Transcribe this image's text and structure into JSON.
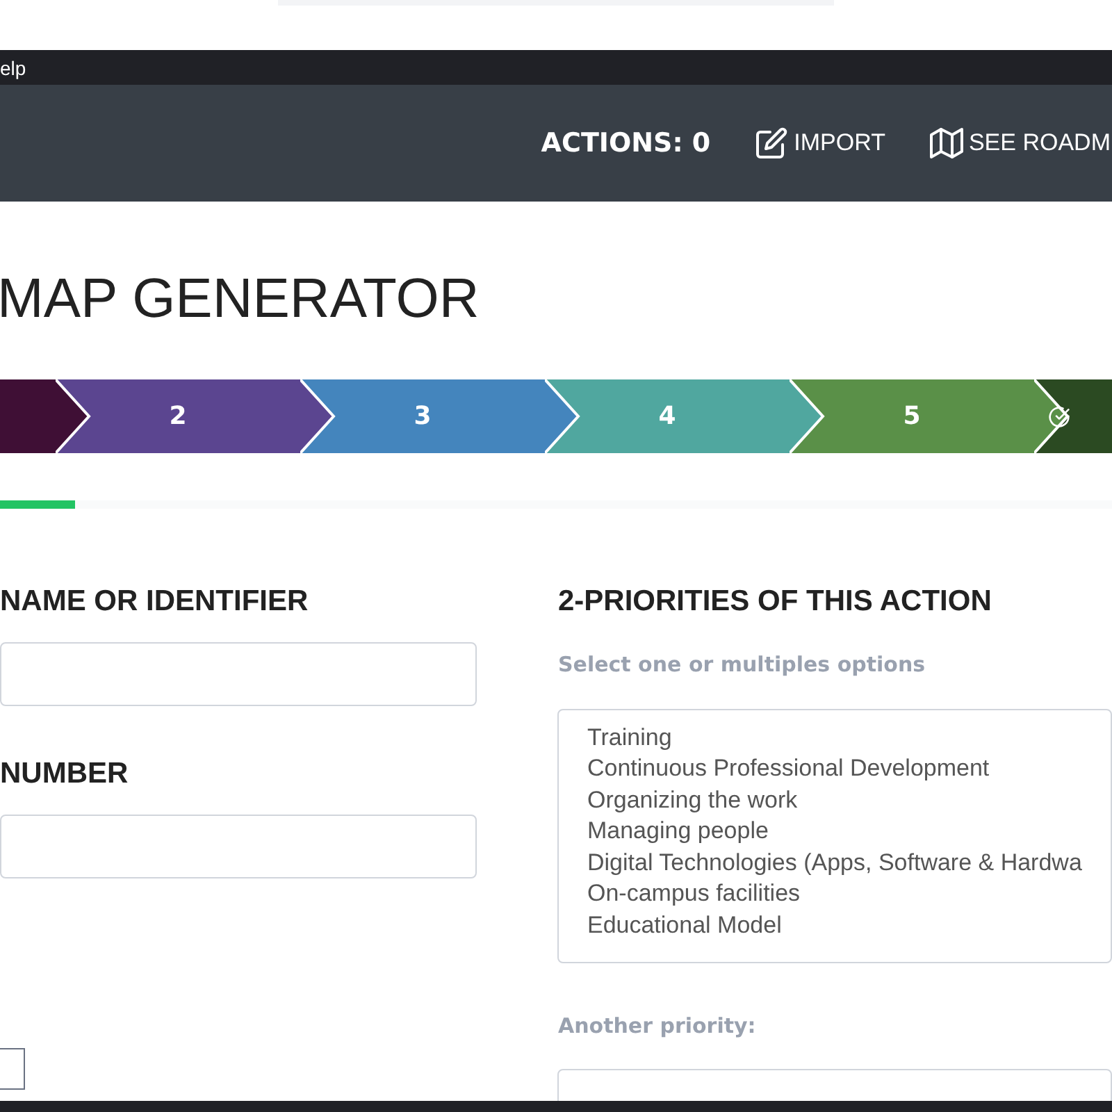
{
  "menu_bar": {
    "item": "elp"
  },
  "header": {
    "actions_count": "ACTIONS: 0",
    "links": [
      {
        "label": "IMPORT",
        "kind": "edit"
      },
      {
        "label": "SEE ROADM",
        "kind": "map"
      }
    ]
  },
  "page_title": "MAP GENERATOR",
  "steps": [
    {
      "kind": "blank",
      "color": "#3f0f35"
    },
    {
      "kind": "number",
      "label": "2",
      "color": "#5b4590"
    },
    {
      "kind": "number",
      "label": "3",
      "color": "#4485bd"
    },
    {
      "kind": "number",
      "label": "4",
      "color": "#50a79f"
    },
    {
      "kind": "number",
      "label": "5",
      "color": "#5a9048"
    },
    {
      "kind": "icon",
      "color": "#2b4a22"
    }
  ],
  "progress": {
    "level": 0.068
  },
  "left_fields": [
    {
      "label": "NAME OR IDENTIFIER"
    },
    {
      "label": "NUMBER"
    }
  ],
  "priorities": {
    "heading": "2-PRIORITIES OF THIS ACTION",
    "hint": "Select one or multiples options",
    "options": [
      {
        "label": "Training",
        "selected": false
      },
      {
        "label": "Continuous Professional Development",
        "selected": false
      },
      {
        "label": "Organizing the work",
        "selected": false
      },
      {
        "label": "Managing people",
        "selected": false
      },
      {
        "label": "Digital Technologies (Apps, Software & Hardwa",
        "selected": false
      },
      {
        "label": "On-campus facilities",
        "selected": false
      },
      {
        "label": "Educational Model",
        "selected": false
      }
    ],
    "another_label": "Another priority:"
  }
}
